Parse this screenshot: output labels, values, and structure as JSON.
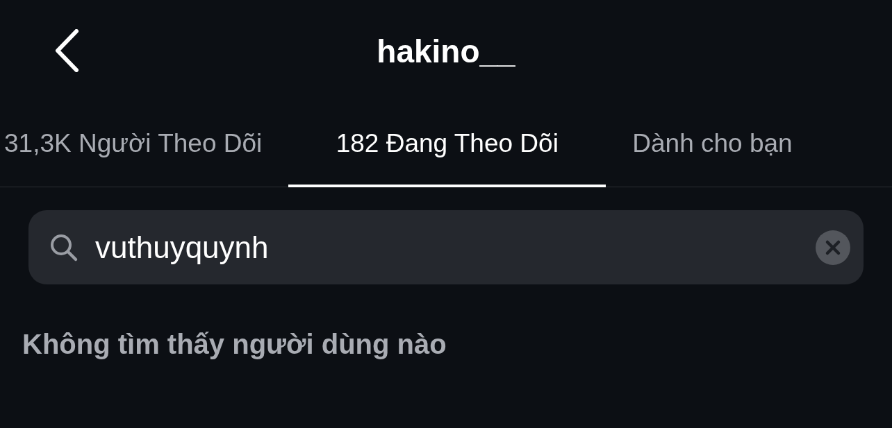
{
  "header": {
    "title": "hakino__"
  },
  "tabs": [
    {
      "label": "31,3K Người Theo Dõi",
      "selected": false
    },
    {
      "label": "182 Đang Theo Dõi",
      "selected": true
    },
    {
      "label": "Dành cho bạn",
      "selected": false
    }
  ],
  "search": {
    "value": "vuthuyquynh"
  },
  "message": "Không tìm thấy người dùng nào"
}
